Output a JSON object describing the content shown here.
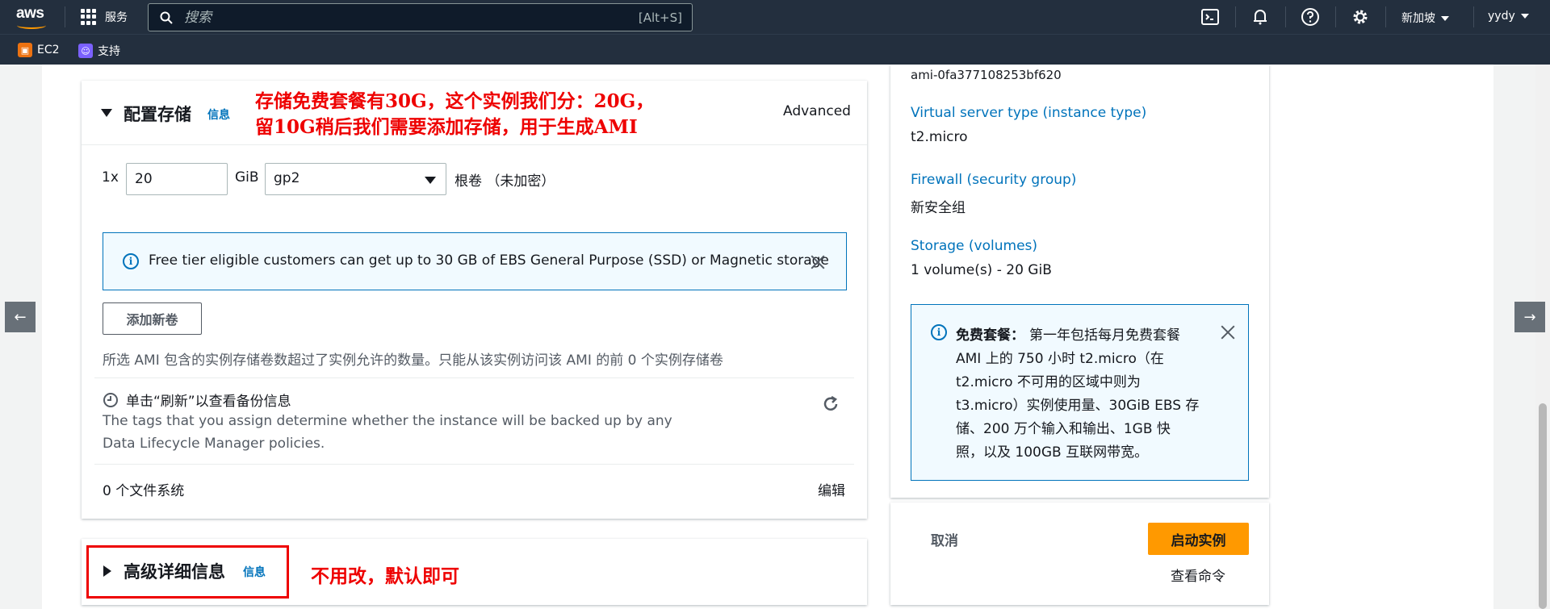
{
  "nav": {
    "logo_text": "aws",
    "services": "服务",
    "search_placeholder": "搜索",
    "search_shortcut": "[Alt+S]",
    "region": "新加坡",
    "user": "yydy"
  },
  "bookmarks": [
    {
      "label": "EC2",
      "color": "#ec7211"
    },
    {
      "label": "支持",
      "color": "#7b61ff"
    }
  ],
  "storage": {
    "title": "配置存储",
    "info": "信息",
    "advanced": "Advanced",
    "count": "1x",
    "size_value": "20",
    "unit": "GiB",
    "volume_type": "gp2",
    "volume_desc": "根卷 （未加密）",
    "alert_text": "Free tier eligible customers can get up to 30 GB of EBS General Purpose (SSD) or Magnetic storage",
    "add_volume": "添加新卷",
    "ami_note": "所选 AMI 包含的实例存储卷数超过了实例允许的数量。只能从该实例访问该 AMI 的前 0 个实例存储卷",
    "backup_title": "单击“刷新”以查看备份信息",
    "backup_desc_1": "The tags that you assign determine whether the instance will be backed up by any",
    "backup_desc_2": "Data Lifecycle Manager policies.",
    "filesystems": "0 个文件系统",
    "edit": "编辑"
  },
  "advanced": {
    "title": "高级详细信息",
    "info": "信息"
  },
  "annotations": {
    "storage_line1": "存储免费套餐有30G，这个实例我们分：20G，",
    "storage_line2": "留10G稍后我们需要添加存储，用于生成AMI",
    "advanced_note": "不用改，默认即可"
  },
  "summary": {
    "ami_id": "ami-0fa377108253bf620",
    "instance_type_label": "Virtual server type (instance type)",
    "instance_type": "t2.micro",
    "firewall_label": "Firewall (security group)",
    "firewall": "新安全组",
    "storage_label": "Storage (volumes)",
    "storage": "1 volume(s) - 20 GiB",
    "free_tier_title": "免费套餐：",
    "free_tier_lines": [
      "第一年包括每月免费套餐",
      "AMI 上的 750 小时 t2.micro（在",
      "t2.micro 不可用的区域中则为",
      "t3.micro）实例使用量、30GiB EBS 存",
      "储、200 万个输入和输出、1GB 快",
      "照，以及 100GB 互联网带宽。"
    ],
    "cancel": "取消",
    "launch": "启动实例",
    "view_command": "查看命令"
  },
  "colors": {
    "nav_bg": "#232f3e",
    "link": "#0073bb",
    "primary": "#ff9900",
    "annotation": "#e00000"
  }
}
